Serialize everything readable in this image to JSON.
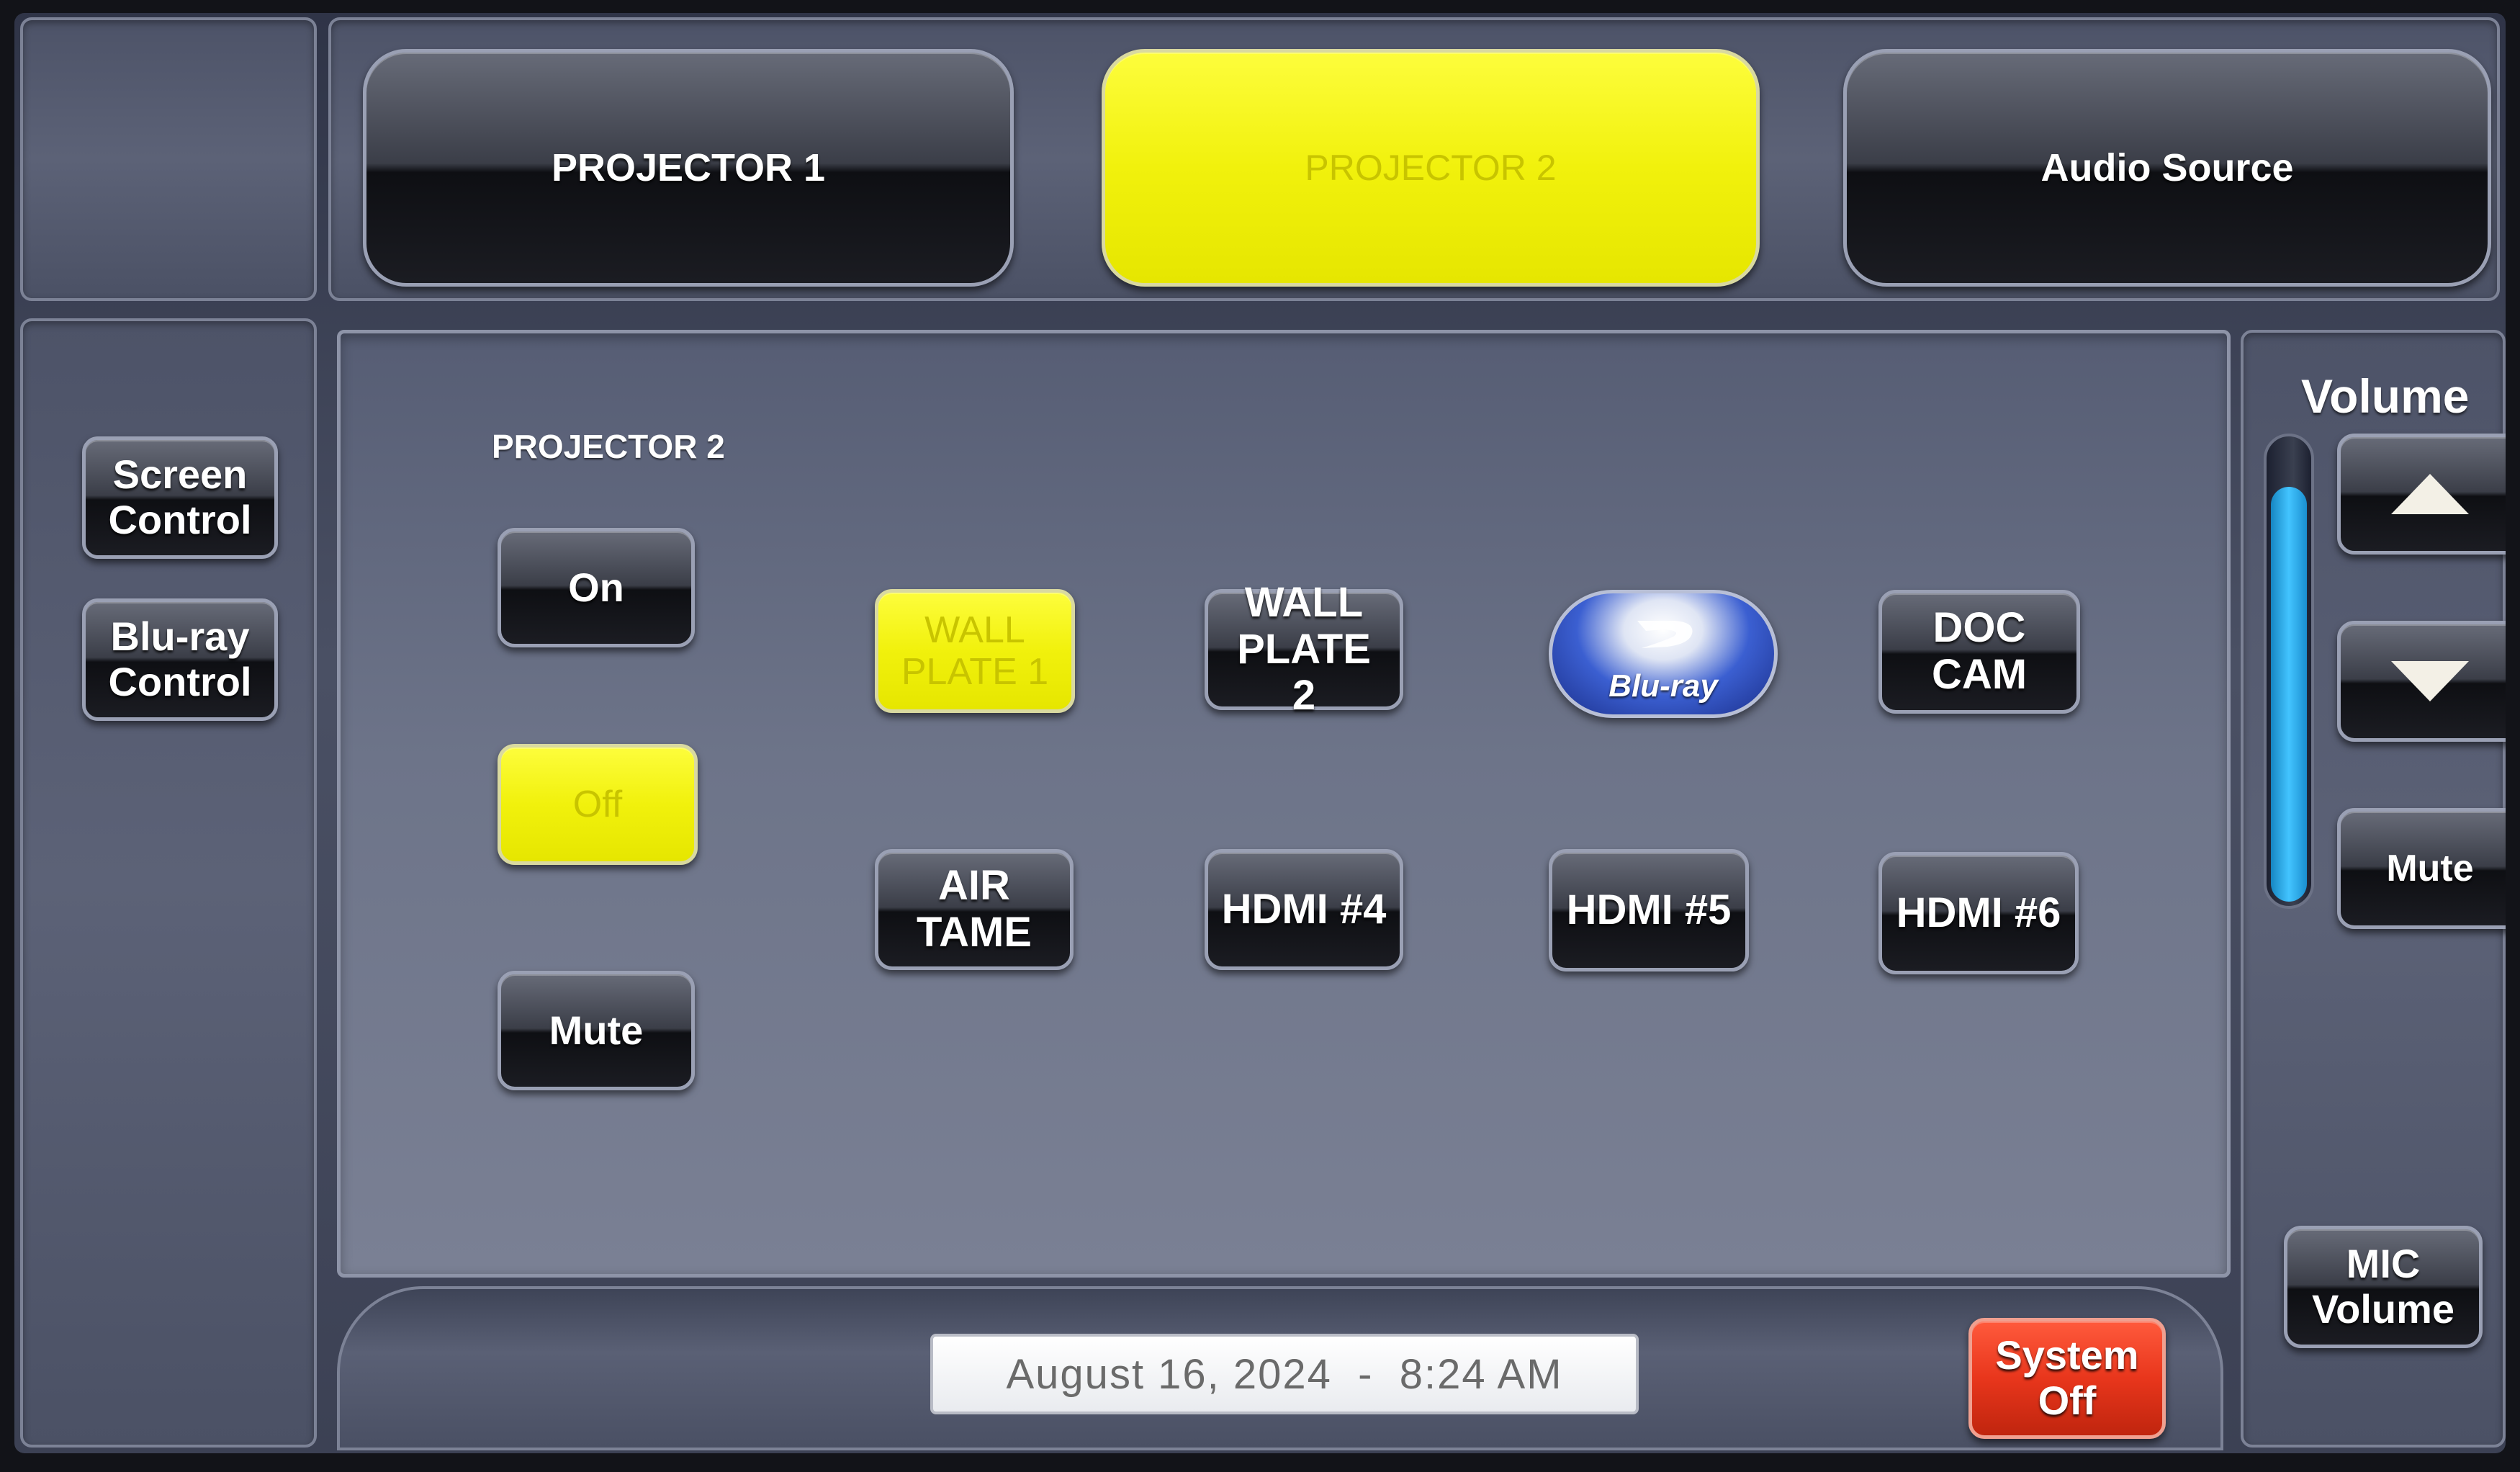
{
  "tabs": [
    {
      "label": "PROJECTOR 1",
      "active": false
    },
    {
      "label": "PROJECTOR 2",
      "active": true
    },
    {
      "label": "Audio Source",
      "active": false
    }
  ],
  "left_sidebar": {
    "screen_control": "Screen Control",
    "bluray_control": "Blu-ray Control"
  },
  "main": {
    "section_label": "PROJECTOR 2",
    "power": {
      "on": "On",
      "off": "Off",
      "mute": "Mute",
      "selected": "Off"
    },
    "sources_row1": [
      {
        "label": "WALL PLATE 1",
        "selected": true
      },
      {
        "label": "WALL PLATE 2",
        "selected": false
      },
      {
        "label": "Blu-ray",
        "selected": false
      },
      {
        "label": "DOC CAM",
        "selected": false
      }
    ],
    "sources_row2": [
      {
        "label": "AIR TAME",
        "selected": false
      },
      {
        "label": "HDMI #4",
        "selected": false
      },
      {
        "label": "HDMI #5",
        "selected": false
      },
      {
        "label": "HDMI #6",
        "selected": false
      }
    ]
  },
  "volume": {
    "title": "Volume",
    "level_fraction": 0.9,
    "mute": "Mute",
    "mic_volume": "MIC Volume",
    "up_icon": "up-arrow-icon",
    "down_icon": "down-arrow-icon"
  },
  "footer": {
    "datetime": "August 16, 2024  -  8:24 AM",
    "system_off": "System Off"
  },
  "colors": {
    "selected": "#f1f10c",
    "system_off": "#e8361c",
    "volume_fill": "#43c4ff"
  }
}
